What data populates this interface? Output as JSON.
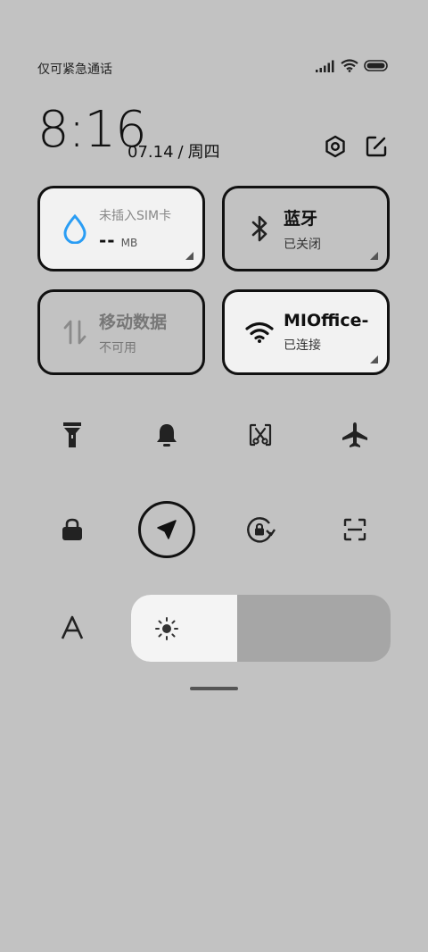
{
  "status_bar": {
    "carrier_text": "仅可紧急通话",
    "icons": [
      "signal-icon",
      "wifi-icon",
      "battery-icon"
    ]
  },
  "header": {
    "time": "8:16",
    "date": "07.14",
    "date_sep": "/",
    "weekday": "周四",
    "buttons": [
      "settings-icon",
      "edit-icon"
    ]
  },
  "tiles": {
    "data_usage": {
      "label": "未插入SIM卡",
      "value": "--",
      "unit": "MB",
      "icon": "water-drop-icon",
      "accent": "#2a9df4"
    },
    "bluetooth": {
      "label": "蓝牙",
      "status": "已关闭",
      "icon": "bluetooth-icon"
    },
    "mobile_data": {
      "label": "移动数据",
      "status": "不可用",
      "icon": "mobile-data-icon"
    },
    "wifi": {
      "label": "MIOffice-",
      "status": "已连接",
      "icon": "wifi-icon"
    }
  },
  "toggles": [
    {
      "name": "flashlight",
      "icon": "flashlight-icon",
      "active": false
    },
    {
      "name": "mute",
      "icon": "bell-icon",
      "active": false
    },
    {
      "name": "screenshot",
      "icon": "screenshot-icon",
      "active": false
    },
    {
      "name": "airplane",
      "icon": "airplane-icon",
      "active": false
    },
    {
      "name": "lock-screen",
      "icon": "lock-icon",
      "active": false
    },
    {
      "name": "location",
      "icon": "location-icon",
      "active": true
    },
    {
      "name": "rotation-lock",
      "icon": "rotation-lock-icon",
      "active": false
    },
    {
      "name": "scanner",
      "icon": "scan-icon",
      "active": false
    }
  ],
  "brightness": {
    "level": 0.41,
    "auto_icon": "font-a-icon",
    "icon": "sun-icon"
  }
}
